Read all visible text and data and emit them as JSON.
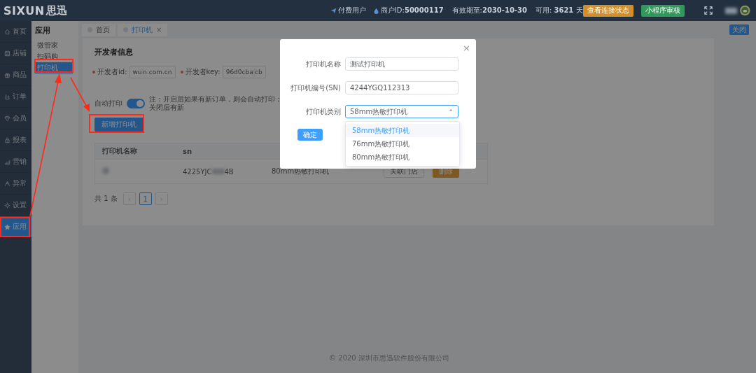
{
  "header": {
    "logo_text": "SIXUN",
    "logo_cn": "思迅",
    "user_type": "付费用户",
    "merchant_label": "商户ID:",
    "merchant_id": "50000117",
    "expiry_label": "有效期至:",
    "expiry": "2030-10-30",
    "remaining_label": "可用:",
    "remaining": "3621",
    "remaining_unit": "天",
    "buttons": [
      {
        "label": "查看连接状态",
        "kind": "warning"
      },
      {
        "label": "小程序审核",
        "kind": "success"
      }
    ]
  },
  "sidebar": {
    "items": [
      {
        "label": "首页",
        "selected": false
      },
      {
        "label": "店铺",
        "selected": false
      },
      {
        "label": "商品",
        "selected": false
      },
      {
        "label": "订单",
        "selected": false
      },
      {
        "label": "会员",
        "selected": false
      },
      {
        "label": "报表",
        "selected": false
      },
      {
        "label": "营销",
        "selected": false
      },
      {
        "label": "异常",
        "selected": false
      },
      {
        "label": "设置",
        "selected": false
      },
      {
        "label": "应用",
        "selected": true
      }
    ]
  },
  "submenu": {
    "title": "应用",
    "items": [
      {
        "label": "微管家",
        "selected": false
      },
      {
        "label": "扫码购",
        "selected": false
      },
      {
        "label": "打印机",
        "selected": true
      }
    ]
  },
  "tabs": [
    {
      "label": "首页",
      "selected": false
    },
    {
      "label": "打印机",
      "selected": true,
      "close_mark": "×"
    }
  ],
  "close_button": "关闭",
  "developer": {
    "title": "开发者信息",
    "fields": [
      {
        "label": "开发者id:",
        "value_start": "wu",
        "value_end": "n.com.cn"
      },
      {
        "label": "开发者key:",
        "value_start": "96d0cba",
        "value_end": "cb"
      }
    ]
  },
  "auto_print": {
    "label": "自动打印",
    "on": true,
    "note": "注：开启后如果有新订单，则会自动打印；关闭后有新"
  },
  "add_button": "新增打印机",
  "table": {
    "columns": [
      "打印机名称",
      "sn"
    ],
    "rows": [
      {
        "sn_start": "4225YJC",
        "sn_end": "4B",
        "type": "80mm热敏打印机",
        "actions": [
          {
            "label": "关联门店",
            "kind": "default"
          },
          {
            "label": "删除",
            "kind": "warning"
          }
        ]
      }
    ]
  },
  "pagination": {
    "total": "共 1 条",
    "prev": "‹",
    "pages": [
      {
        "label": "1",
        "selected": true
      }
    ],
    "next": "›"
  },
  "footer": "© 2020 深圳市思迅软件股份有限公司",
  "dialog": {
    "close_mark": "×",
    "fields": [
      {
        "label": "打印机名称",
        "value": "测试打印机",
        "kind": "text"
      },
      {
        "label": "打印机编号(SN)",
        "value": "4244YGQ112313",
        "kind": "text"
      },
      {
        "label": "打印机类别",
        "value": "58mm热敏打印机",
        "kind": "select",
        "expanded": true,
        "caret": "⌃"
      }
    ],
    "options": [
      {
        "label": "58mm热敏打印机",
        "selected": true
      },
      {
        "label": "76mm热敏打印机",
        "selected": false
      },
      {
        "label": "80mm热敏打印机",
        "selected": false
      }
    ],
    "confirm": "确定"
  }
}
